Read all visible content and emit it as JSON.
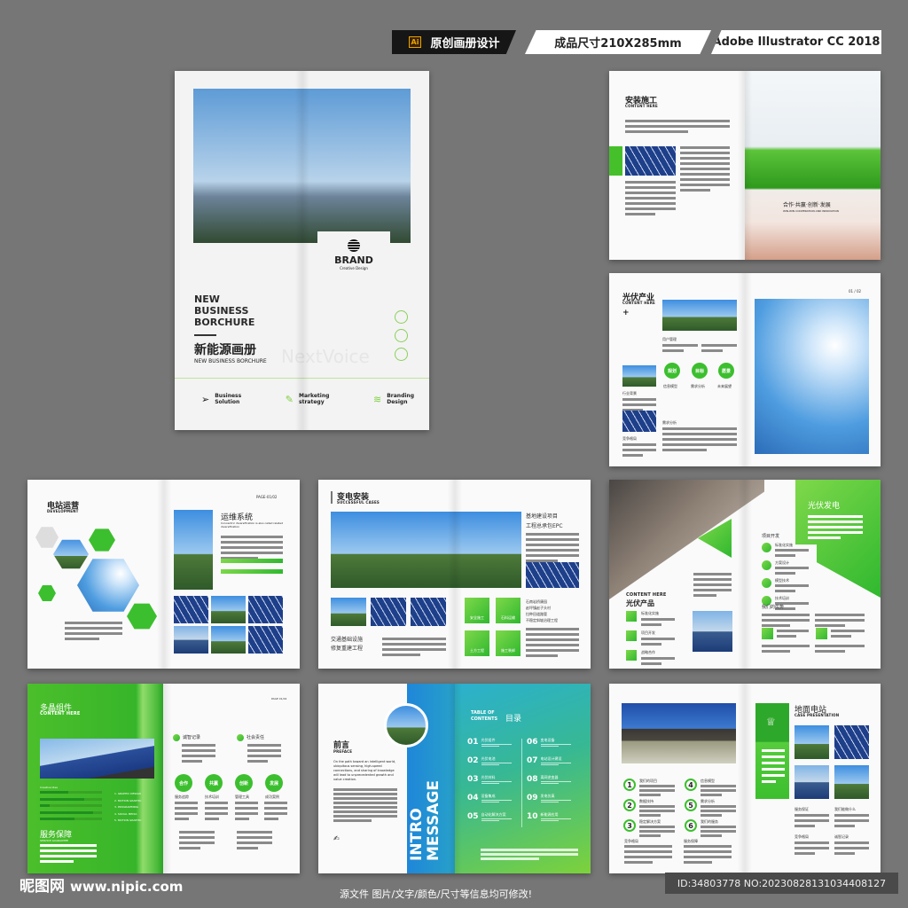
{
  "header": {
    "ai_badge": "Ai",
    "tag1": "原创画册设计",
    "tag2": "成品尺寸210X285mm",
    "tag3": "Adobe Illustrator CC 2018"
  },
  "cover": {
    "brand": "BRAND",
    "brand_sub": "Creative Design",
    "title": [
      "NEW",
      "BUSINESS",
      "BORCHURE"
    ],
    "cn_title": "新能源画册",
    "subtitle": "NEW BUSINESS BORCHURE",
    "watermark": "NextVoice",
    "features": [
      {
        "icon": "paper-plane-icon",
        "label": [
          "Business",
          "Solution"
        ]
      },
      {
        "icon": "pen-icon",
        "label": [
          "Marketing",
          "strategy"
        ]
      },
      {
        "icon": "layers-icon",
        "label": [
          "Branding",
          "Design"
        ]
      }
    ]
  },
  "spread1": {
    "title": "安装施工",
    "en": "CONTENT HERE",
    "banner": "合作·共赢·创新·发展",
    "banner_en": "WIN-WIN COOPERATION AND INNOVATION"
  },
  "spread2": {
    "title": "光伏产业",
    "en": "CONTENT HERE",
    "page": "01 / 02",
    "s1": "用户管理",
    "s2": "行业背景",
    "s3": "竞争格局",
    "s4": "需求分析",
    "circles": [
      {
        "label": "规划",
        "cap": "信息模型"
      },
      {
        "label": "目标",
        "cap": "需求分析"
      },
      {
        "label": "愿景",
        "cap": "未来展望"
      }
    ]
  },
  "spread3": {
    "title": "电站运营",
    "en": "DEVELOPMENT",
    "page": "PAGE-01/02",
    "heading": "运维系统",
    "desc": "Concentric diversification is also called related diversification"
  },
  "spread4": {
    "title": "变电安装",
    "en": "SUCCESSFUL CASES",
    "right_title": [
      "基地建设项目",
      "工程总承包EPC"
    ],
    "bottom_title": [
      "交通基础设施",
      "修复重建工程"
    ],
    "tiles": [
      "安全施工",
      "石料运输",
      "土方工程",
      "施工装卸"
    ],
    "list": [
      "石南岩桥康园",
      "赵坪镇赵子头村",
      "拉种田道路管",
      "不稳定斜坡治理工程"
    ]
  },
  "spread5": {
    "title": "光伏发电",
    "left_en": "CONTENT HERE",
    "left_cn": "光伏产品",
    "left_items": [
      "标准化实施",
      "项目开发",
      "战略合作"
    ],
    "section": "项目开发",
    "right_items": [
      "标准化实施",
      "方案设计",
      "模型技术",
      "技术培训"
    ],
    "adv": "我们的优势"
  },
  "spread6": {
    "title": "多晶组件",
    "en": "CONTENT HERE",
    "creative": "Creative Idea",
    "list": [
      "1. GRAPHIC DESIGN",
      "2. MOTION GRAPHIC",
      "3. PROGRAMMING",
      "4. SOCIAL MEDIA",
      "5. MOTION GRAPHIC"
    ],
    "progress": [
      0.45,
      0.72,
      0.15,
      0.85,
      0.55
    ],
    "service": "服务保障",
    "service_en": "SERVICE GUARANTEE",
    "page": "PAGE 01/02",
    "h1": "诚智记录",
    "h2": "社会责任",
    "circles": [
      {
        "label": "合作",
        "cap": "服务追踪"
      },
      {
        "label": "共赢",
        "cap": "技术培训"
      },
      {
        "label": "创新",
        "cap": "管理工具"
      },
      {
        "label": "发展",
        "cap": "成功案例"
      }
    ]
  },
  "spread7": {
    "preface": "前言",
    "preface_en": "PREFACE",
    "body": "On the path toward an intelligent world, ubiquitous sensing, high-speed connections, and sharing of knowledge will lead to unprecedented growth and value creation.",
    "intro": "INTRO",
    "message": "MESSAGE",
    "toc_en": [
      "TABLE OF",
      "CONTENTS"
    ],
    "toc_cn": "目录",
    "toc": [
      {
        "n": "01",
        "t": "光伏组件"
      },
      {
        "n": "02",
        "t": "光伏电池"
      },
      {
        "n": "03",
        "t": "光伏材料"
      },
      {
        "n": "04",
        "t": "设备集成"
      },
      {
        "n": "05",
        "t": "自动化解决方案"
      },
      {
        "n": "06",
        "t": "变电设备"
      },
      {
        "n": "07",
        "t": "电站设计建设"
      },
      {
        "n": "08",
        "t": "离网逆变器"
      },
      {
        "n": "09",
        "t": "发电仿真"
      },
      {
        "n": "10",
        "t": "新能源应用"
      }
    ]
  },
  "spread8": {
    "title": "地面电站",
    "en": "CASE PRESENTATION",
    "items": [
      {
        "n": "1",
        "t": "我们的项目"
      },
      {
        "n": "2",
        "t": "数据技持"
      },
      {
        "n": "3",
        "t": "稳定解决方案"
      },
      {
        "n": "4",
        "t": "信息模型"
      },
      {
        "n": "5",
        "t": "需求分析"
      },
      {
        "n": "6",
        "t": "我们的服务"
      }
    ],
    "sec": [
      "竞争格局",
      "服务保障"
    ],
    "right_sec": [
      "服务保证",
      "我们能做什么",
      "竞争格局",
      "诚智记录"
    ]
  },
  "footer": {
    "logo": "昵图网",
    "url": "www.nipic.com",
    "note": "源文件 图片/文字/颜色/尺寸等信息均可修改!",
    "id": "ID:34803778 NO:20230828131034408127"
  },
  "colors": {
    "accent": "#3cbf2e",
    "dark": "#1a1a1a",
    "bg": "#767676"
  }
}
